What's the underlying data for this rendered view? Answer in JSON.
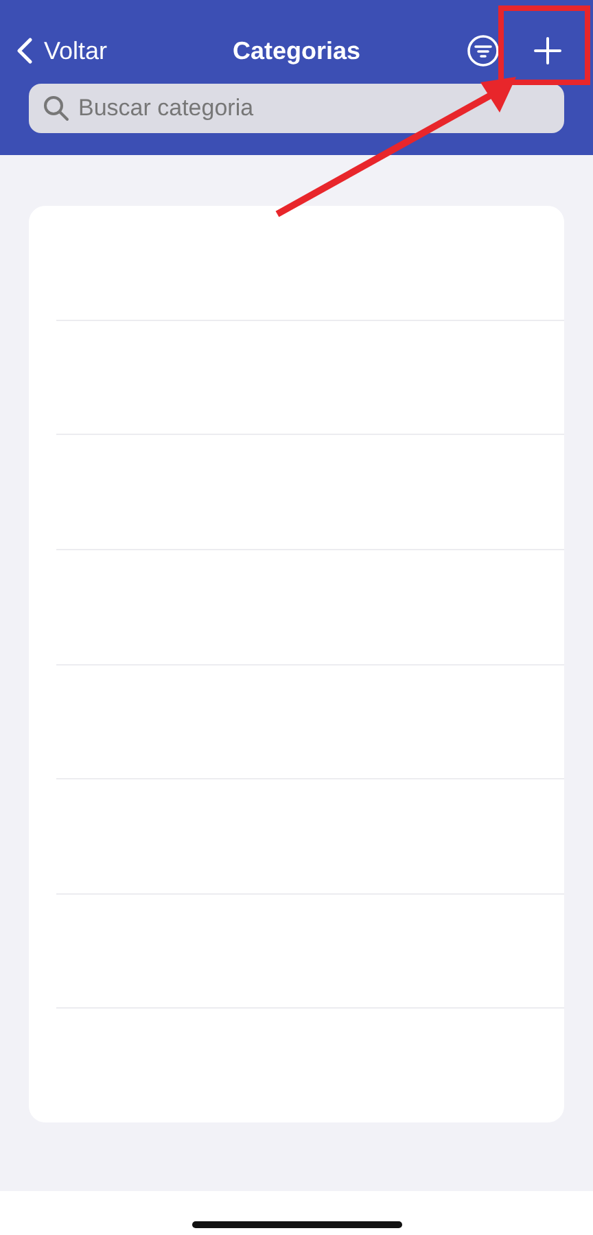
{
  "nav": {
    "back_label": "Voltar",
    "title": "Categorias"
  },
  "search": {
    "placeholder": "Buscar categoria"
  },
  "annotations": {
    "highlight_box": {
      "color": "#e8262b"
    },
    "arrow": {
      "color": "#e8262b"
    }
  }
}
